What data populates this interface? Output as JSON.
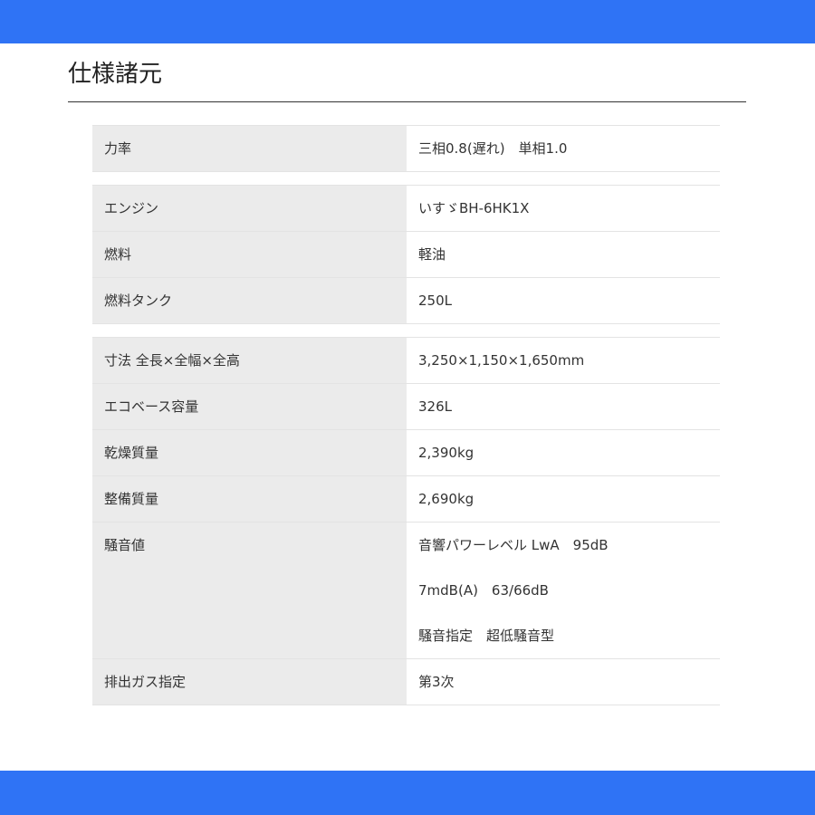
{
  "header_bar": {
    "color": "#2f73f5"
  },
  "footer_bar": {
    "color": "#2f73f5"
  },
  "title": "仕様諸元",
  "groups": [
    {
      "rows": [
        {
          "label": "力率",
          "values": [
            "三相0.8(遅れ)　単相1.0"
          ]
        }
      ]
    },
    {
      "rows": [
        {
          "label": "エンジン",
          "values": [
            "いすゞBH-6HK1X"
          ]
        },
        {
          "label": "燃料",
          "values": [
            "軽油"
          ]
        },
        {
          "label": "燃料タンク",
          "values": [
            "250L"
          ]
        }
      ]
    },
    {
      "rows": [
        {
          "label": "寸法 全長×全幅×全高",
          "values": [
            "3,250×1,150×1,650mm"
          ]
        },
        {
          "label": "エコベース容量",
          "values": [
            "326L"
          ]
        },
        {
          "label": "乾燥質量",
          "values": [
            "2,390kg"
          ]
        },
        {
          "label": "整備質量",
          "values": [
            "2,690kg"
          ]
        },
        {
          "label": "騒音値",
          "values": [
            "音響パワーレベル LwA　95dB",
            "7mdB(A)　63/66dB",
            "騒音指定　超低騒音型"
          ]
        },
        {
          "label": "排出ガス指定",
          "values": [
            "第3次"
          ]
        }
      ]
    }
  ]
}
